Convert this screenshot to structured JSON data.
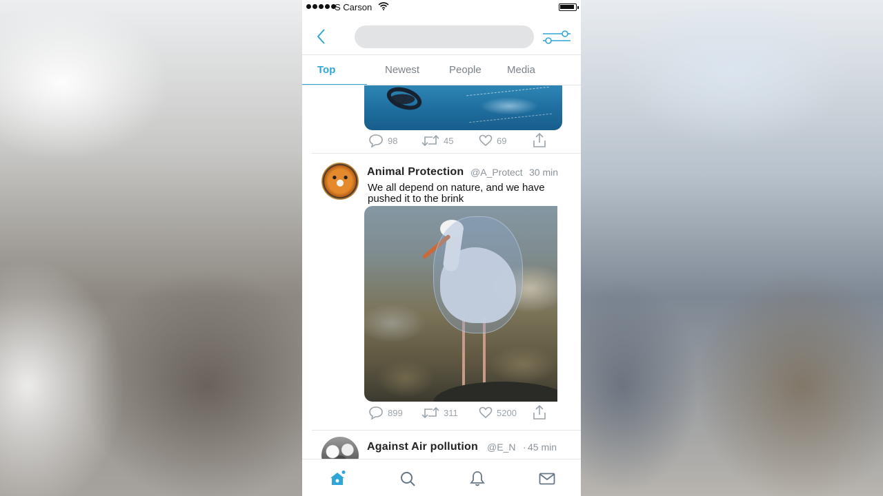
{
  "status_bar": {
    "carrier": "S Carson"
  },
  "header": {
    "search": {
      "placeholder": ""
    }
  },
  "tabs": [
    {
      "label": "Top",
      "active": true
    },
    {
      "label": "Newest",
      "active": false
    },
    {
      "label": "People",
      "active": false
    },
    {
      "label": "Media",
      "active": false
    }
  ],
  "feed": {
    "tweets": [
      {
        "media": "ocean-plastic-photo",
        "stats": {
          "replies": "98",
          "retweets": "45",
          "likes": "69"
        }
      },
      {
        "author": "Animal Protection",
        "handle": "@A_Protect",
        "time": "30 min",
        "text": "We all depend on nature, and we have pushed it to the brink",
        "media": "stork-in-plastic-bag-photo",
        "stats": {
          "replies": "899",
          "retweets": "311",
          "likes": "5200"
        }
      },
      {
        "author": "Against Air pollution",
        "handle": "@E_N",
        "time": "45 min"
      }
    ]
  },
  "tabbar": [
    {
      "icon": "home-icon",
      "active": true
    },
    {
      "icon": "search-icon",
      "active": false
    },
    {
      "icon": "bell-icon",
      "active": false
    },
    {
      "icon": "mail-icon",
      "active": false
    }
  ],
  "colors": {
    "accent": "#2ea6d8",
    "muted": "#9aa3aa",
    "divider": "#e3e6e8"
  }
}
